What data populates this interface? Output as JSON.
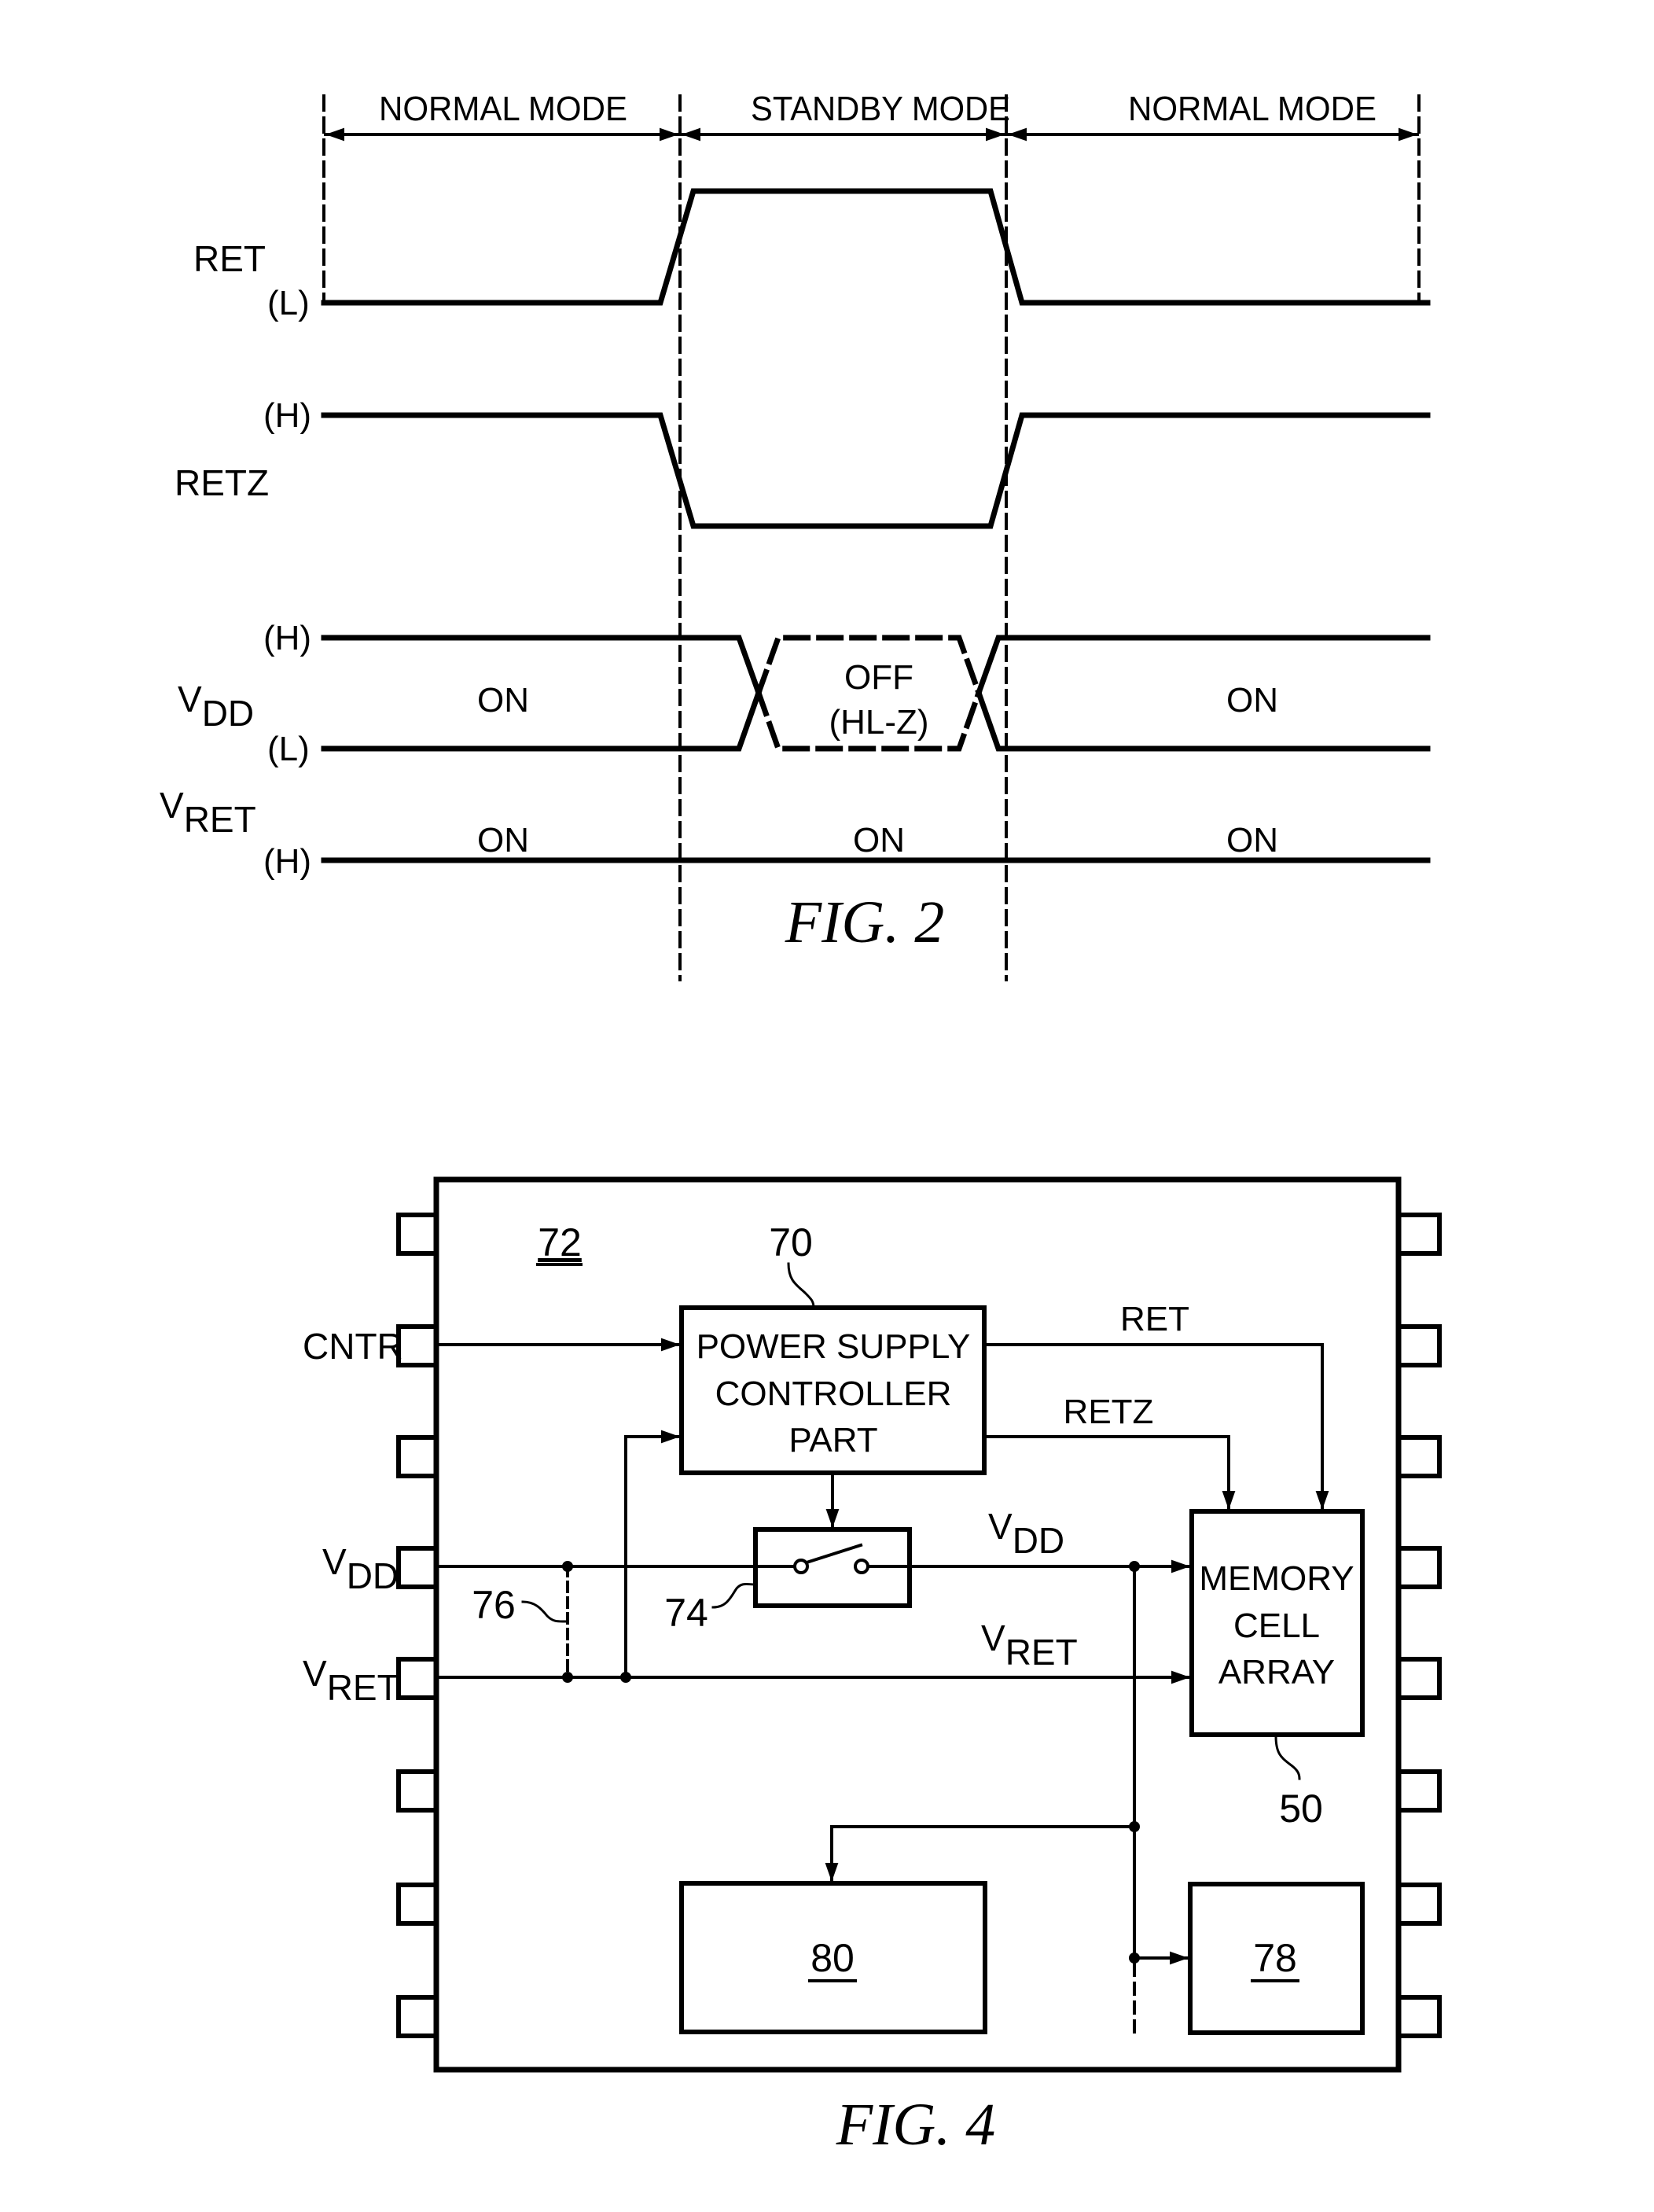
{
  "colors": {
    "ink": "#000000",
    "paper": "#ffffff"
  },
  "fig2": {
    "caption": "FIG. 2",
    "modes": [
      "NORMAL MODE",
      "STANDBY MODE",
      "NORMAL MODE"
    ],
    "signals": {
      "ret": {
        "name": "RET",
        "level": "(L)"
      },
      "retz": {
        "name": "RETZ",
        "level": "(H)"
      },
      "vdd": {
        "name": "V",
        "sub": "DD",
        "level_high": "(H)",
        "level_low": "(L)",
        "states": [
          "ON",
          "OFF",
          "(HL-Z)",
          "ON"
        ]
      },
      "vret": {
        "name": "V",
        "sub": "RET",
        "level": "(H)",
        "states": [
          "ON",
          "ON",
          "ON"
        ]
      }
    }
  },
  "fig4": {
    "caption": "FIG. 4",
    "chip_ref": "72",
    "psc": {
      "ref": "70",
      "lines": [
        "POWER SUPPLY",
        "CONTROLLER",
        "PART"
      ]
    },
    "switch_ref": "74",
    "short_ref": "76",
    "memory": {
      "ref": "50",
      "lines": [
        "MEMORY",
        "CELL",
        "ARRAY"
      ]
    },
    "block80": "80",
    "block78": "78",
    "pins": {
      "cntr": "CNTR",
      "vdd_main": "V",
      "vdd_sub": "DD",
      "vret_main": "V",
      "vret_sub": "RET"
    },
    "nets": {
      "ret": "RET",
      "retz": "RETZ",
      "vdd_main": "V",
      "vdd_sub": "DD",
      "vret_main": "V",
      "vret_sub": "RET"
    }
  }
}
